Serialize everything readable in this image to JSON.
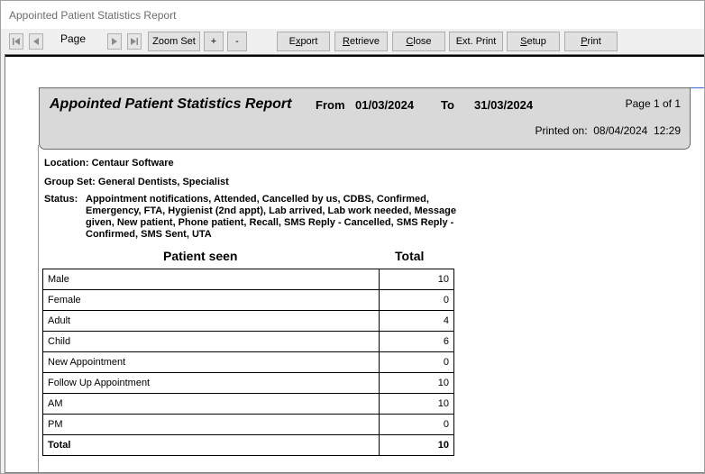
{
  "window": {
    "title": "Appointed Patient Statistics Report"
  },
  "toolbar": {
    "page_label": "Page",
    "zoom_set": "Zoom Set",
    "zoom_in": "+",
    "zoom_out": "-",
    "export_pre": "E",
    "export_ul": "x",
    "export_post": "port",
    "retrieve_ul": "R",
    "retrieve_post": "etrieve",
    "close_ul": "C",
    "close_post": "lose",
    "extprint": "Ext. Print",
    "setup_ul": "S",
    "setup_post": "etup",
    "print_ul": "P",
    "print_post": "rint"
  },
  "report": {
    "title": "Appointed Patient Statistics Report",
    "from_label": "From",
    "from_date": "01/03/2024",
    "to_label": "To",
    "to_date": "31/03/2024",
    "page_info": "Page 1 of 1",
    "printed_label": "Printed on:",
    "printed_date": "08/04/2024",
    "printed_time": "12:29",
    "location_label": "Location:",
    "location": "Centaur Software",
    "groupset_label": "Group Set:",
    "groupset": "General Dentists, Specialist",
    "status_label": "Status:",
    "status_line1": "Appointment notifications, Attended, Cancelled by us, CDBS, Confirmed,",
    "status_line2": "Emergency, FTA, Hygienist (2nd appt), Lab arrived, Lab work needed, Message",
    "status_line3": "given, New patient, Phone patient, Recall, SMS Reply - Cancelled, SMS Reply -",
    "status_line4": "Confirmed, SMS Sent, UTA",
    "col_patient_seen": "Patient seen",
    "col_total": "Total",
    "rows": [
      {
        "label": "Male",
        "value": "10"
      },
      {
        "label": "Female",
        "value": "0"
      },
      {
        "label": "Adult",
        "value": "4"
      },
      {
        "label": "Child",
        "value": "6"
      },
      {
        "label": "New Appointment",
        "value": "0"
      },
      {
        "label": "Follow Up Appointment",
        "value": "10"
      },
      {
        "label": "AM",
        "value": "10"
      },
      {
        "label": "PM",
        "value": "0"
      }
    ],
    "total_label": "Total",
    "total_value": "10"
  }
}
